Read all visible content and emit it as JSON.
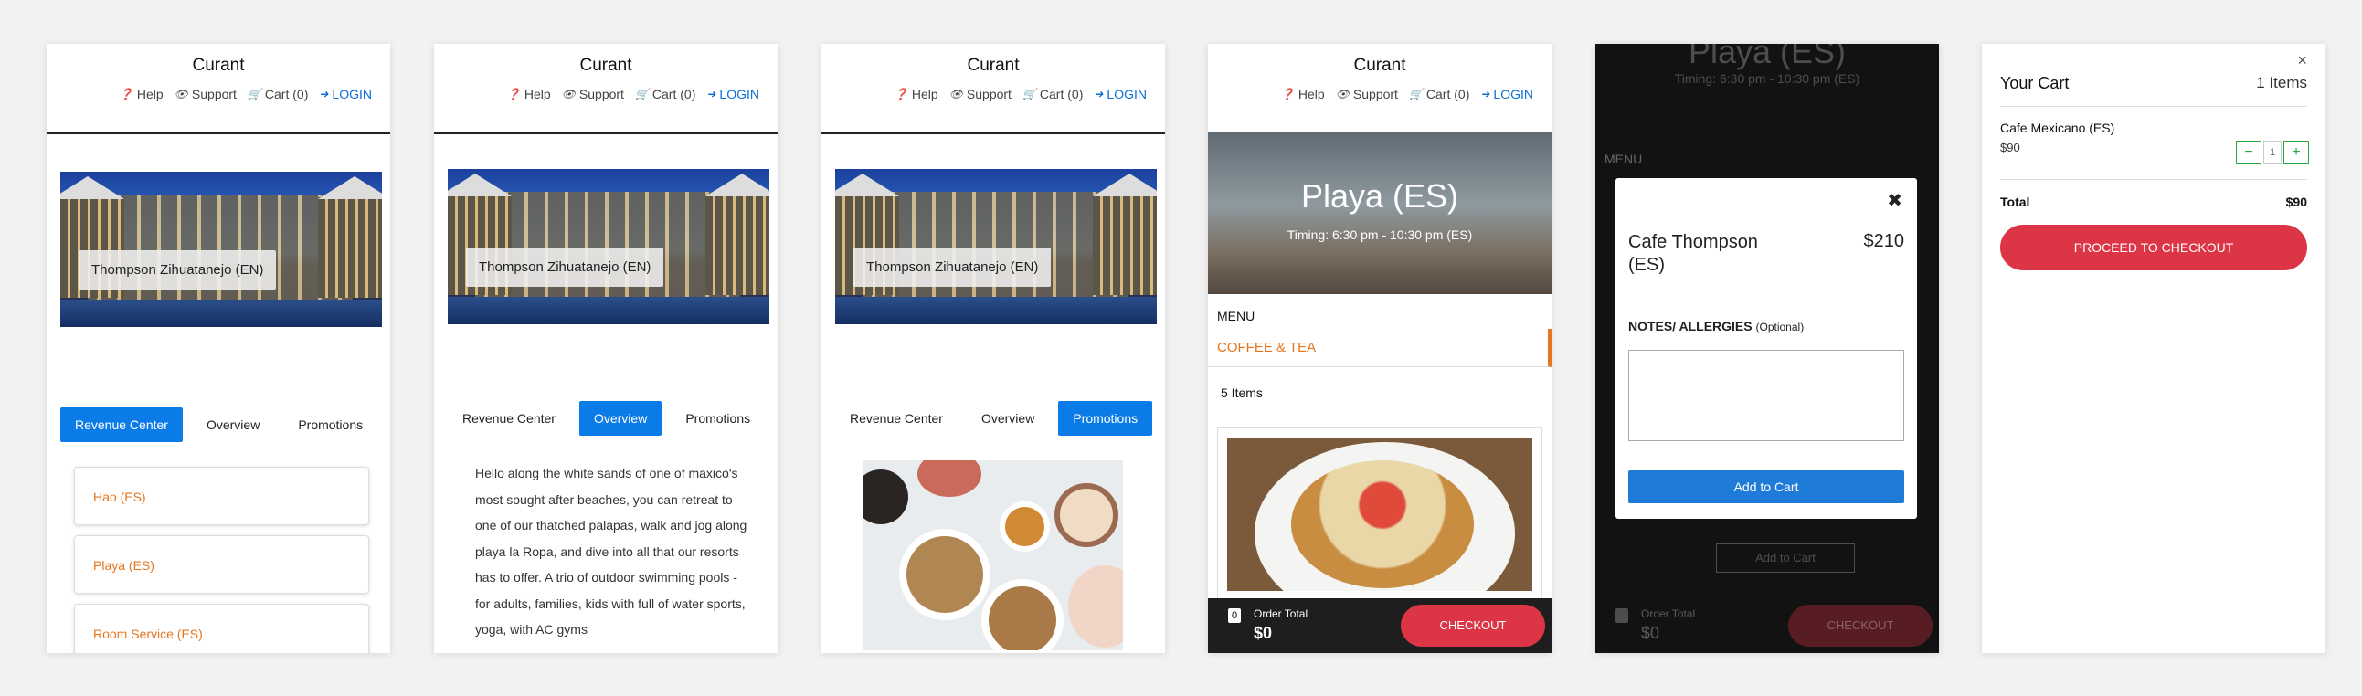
{
  "header": {
    "brand": "Curant",
    "nav": {
      "help": "Help",
      "support": "Support",
      "cart": "Cart (0)",
      "login": "LOGIN"
    }
  },
  "hotel": {
    "name": "Thompson Zihuatanejo (EN)"
  },
  "tabs": {
    "revenue_center": "Revenue Center",
    "overview": "Overview",
    "promotions": "Promotions"
  },
  "revenue_centers": [
    "Hao (ES)",
    "Playa (ES)",
    "Room Service (ES)"
  ],
  "overview_text": "Hello along the white sands of one of maxico's most sought after beaches, you can retreat to one of our thatched palapas, walk and jog along playa la Ropa, and dive into all that our resorts has to offer. A trio of outdoor swimming pools - for adults, families, kids with full of water sports, yoga, with AC gyms",
  "venue": {
    "name": "Playa (ES)",
    "timing": "Timing: 6:30 pm - 10:30 pm (ES)"
  },
  "menu": {
    "label": "MENU",
    "category": "COFFEE & TEA",
    "item_count": "5 Items"
  },
  "order_bar": {
    "badge": "0",
    "label": "Order Total",
    "amount": "$0",
    "checkout": "CHECKOUT"
  },
  "modal": {
    "close": "✖",
    "item_name": "Cafe Thompson (ES)",
    "price": "$210",
    "notes_label": "NOTES/ ALLERGIES",
    "notes_optional": "(Optional)",
    "notes_value": "",
    "add_button": "Add to Cart",
    "bg_add": "Add to Cart"
  },
  "cart": {
    "close": "×",
    "title": "Your Cart",
    "count": "1 Items",
    "item_name": "Cafe Mexicano (ES)",
    "item_price": "$90",
    "qty": "1",
    "total_label": "Total",
    "total_value": "$90",
    "proceed": "PROCEED TO CHECKOUT"
  },
  "colors": {
    "accent_blue": "#0b7be8",
    "orange": "#e7751d",
    "red": "#dc3545",
    "green": "#28a745"
  }
}
